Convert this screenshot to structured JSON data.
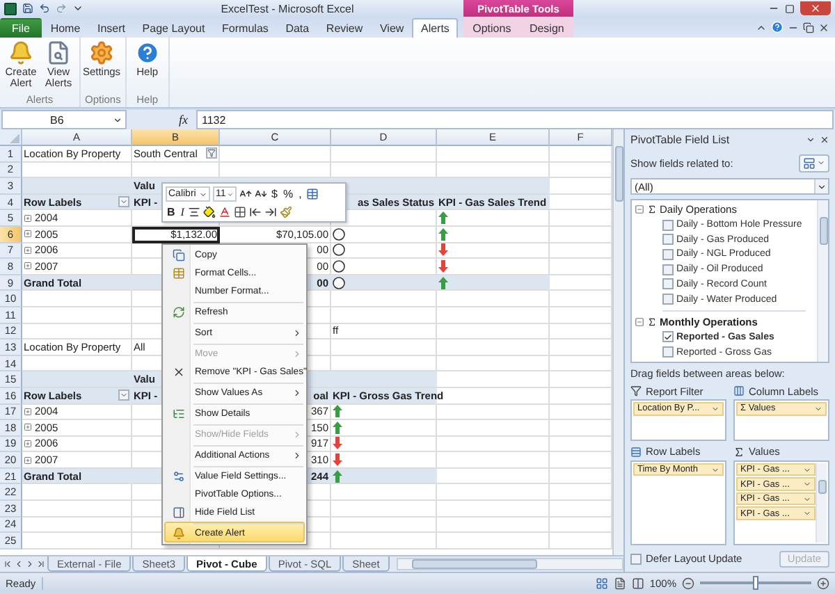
{
  "window": {
    "title": "ExcelTest - Microsoft Excel",
    "contextual_label": "PivotTable Tools"
  },
  "ribbon_tabs": [
    {
      "label": "File",
      "kind": "file",
      "selected": false
    },
    {
      "label": "Home",
      "kind": "main",
      "selected": false
    },
    {
      "label": "Insert",
      "kind": "main",
      "selected": false
    },
    {
      "label": "Page Layout",
      "kind": "main",
      "selected": false
    },
    {
      "label": "Formulas",
      "kind": "main",
      "selected": false
    },
    {
      "label": "Data",
      "kind": "main",
      "selected": false
    },
    {
      "label": "Review",
      "kind": "main",
      "selected": false
    },
    {
      "label": "View",
      "kind": "main",
      "selected": false
    },
    {
      "label": "Alerts",
      "kind": "main",
      "selected": true
    },
    {
      "label": "Options",
      "kind": "contextual",
      "selected": false
    },
    {
      "label": "Design",
      "kind": "contextual",
      "selected": false
    }
  ],
  "ribbon_groups": [
    {
      "label": "Alerts",
      "buttons": [
        {
          "label": "Create Alert",
          "kind": "bell"
        },
        {
          "label": "View Alerts",
          "kind": "view"
        }
      ]
    },
    {
      "label": "Options",
      "buttons": [
        {
          "label": "Settings",
          "kind": "gear"
        }
      ]
    },
    {
      "label": "Help",
      "buttons": [
        {
          "label": "Help",
          "kind": "help"
        }
      ]
    }
  ],
  "formula_bar": {
    "name_box": "B6",
    "fx": "fx",
    "value": "1132"
  },
  "columns": [
    {
      "label": "A",
      "selected": false
    },
    {
      "label": "B",
      "selected": true
    },
    {
      "label": "C",
      "selected": false
    },
    {
      "label": "D",
      "selected": false
    },
    {
      "label": "E",
      "selected": false
    },
    {
      "label": "F",
      "selected": false
    }
  ],
  "rows": [
    {
      "number": "1",
      "selected": false,
      "kind": "plain",
      "cells": [
        {
          "kind": "text",
          "text": "Location By Property"
        },
        {
          "kind": "filter",
          "text": "South Central"
        }
      ]
    },
    {
      "number": "2",
      "selected": false,
      "kind": "plain",
      "cells": []
    },
    {
      "number": "3",
      "selected": false,
      "kind": "header",
      "cells": [
        {},
        {
          "kind": "text",
          "text": "Valu"
        },
        {},
        {},
        {}
      ]
    },
    {
      "number": "4",
      "selected": false,
      "kind": "header",
      "cells": [
        {
          "kind": "dropdown",
          "text": "Row Labels"
        },
        {
          "kind": "text",
          "text": "KPI -"
        },
        {},
        {
          "kind": "number",
          "text": "as Sales Status"
        },
        {
          "kind": "text",
          "text": "KPI - Gas Sales Trend"
        }
      ]
    },
    {
      "number": "5",
      "selected": false,
      "kind": "plain",
      "cells": [
        {
          "kind": "expand",
          "text": "2004"
        },
        {},
        {},
        {},
        {
          "kind": "up"
        }
      ]
    },
    {
      "number": "6",
      "selected": true,
      "kind": "plain",
      "cells": [
        {
          "kind": "expand",
          "text": "2005"
        },
        {
          "kind": "active",
          "text": "$1,132.00"
        },
        {
          "kind": "number",
          "text": "$70,105.00"
        },
        {
          "kind": "status"
        },
        {
          "kind": "up"
        }
      ]
    },
    {
      "number": "7",
      "selected": false,
      "kind": "plain",
      "cells": [
        {
          "kind": "expand",
          "text": "2006"
        },
        {},
        {
          "kind": "number",
          "text": "00"
        },
        {
          "kind": "status"
        },
        {
          "kind": "down"
        }
      ]
    },
    {
      "number": "8",
      "selected": false,
      "kind": "plain",
      "cells": [
        {
          "kind": "expand",
          "text": "2007"
        },
        {},
        {
          "kind": "number",
          "text": "00"
        },
        {
          "kind": "status"
        },
        {
          "kind": "down"
        }
      ]
    },
    {
      "number": "9",
      "selected": false,
      "kind": "total",
      "cells": [
        {
          "kind": "text",
          "text": "Grand Total"
        },
        {},
        {
          "kind": "number",
          "text": "00"
        },
        {
          "kind": "status"
        },
        {
          "kind": "up"
        }
      ]
    },
    {
      "number": "10",
      "selected": false,
      "kind": "plain",
      "cells": []
    },
    {
      "number": "11",
      "selected": false,
      "kind": "plain",
      "cells": []
    },
    {
      "number": "12",
      "selected": false,
      "kind": "plain",
      "cells": [
        {},
        {},
        {},
        {
          "kind": "text",
          "text": "ff"
        }
      ]
    },
    {
      "number": "13",
      "selected": false,
      "kind": "plain",
      "cells": [
        {
          "kind": "text",
          "text": "Location By Property"
        },
        {
          "kind": "text",
          "text": "All"
        }
      ]
    },
    {
      "number": "14",
      "selected": false,
      "kind": "plain",
      "cells": []
    },
    {
      "number": "15",
      "selected": false,
      "kind": "header",
      "cells": [
        {},
        {
          "kind": "text",
          "text": "Valu"
        },
        {},
        {}
      ]
    },
    {
      "number": "16",
      "selected": false,
      "kind": "header",
      "cells": [
        {
          "kind": "dropdown",
          "text": "Row Labels"
        },
        {
          "kind": "text",
          "text": "KPI -"
        },
        {
          "kind": "number",
          "text": "oal"
        },
        {
          "kind": "text",
          "text": "KPI - Gross Gas Trend"
        }
      ]
    },
    {
      "number": "17",
      "selected": false,
      "kind": "plain",
      "cells": [
        {
          "kind": "expand",
          "text": "2004"
        },
        {},
        {
          "kind": "number",
          "text": "367"
        },
        {
          "kind": "up"
        }
      ]
    },
    {
      "number": "18",
      "selected": false,
      "kind": "plain",
      "cells": [
        {
          "kind": "expand",
          "text": "2005"
        },
        {},
        {
          "kind": "number",
          "text": "150"
        },
        {
          "kind": "up"
        }
      ]
    },
    {
      "number": "19",
      "selected": false,
      "kind": "plain",
      "cells": [
        {
          "kind": "expand",
          "text": "2006"
        },
        {},
        {
          "kind": "number",
          "text": "917"
        },
        {
          "kind": "down"
        }
      ]
    },
    {
      "number": "20",
      "selected": false,
      "kind": "plain",
      "cells": [
        {
          "kind": "expand",
          "text": "2007"
        },
        {},
        {
          "kind": "number",
          "text": "310"
        },
        {
          "kind": "down"
        }
      ]
    },
    {
      "number": "21",
      "selected": false,
      "kind": "total",
      "cells": [
        {
          "kind": "text",
          "text": "Grand Total"
        },
        {},
        {
          "kind": "number",
          "text": "244"
        },
        {
          "kind": "up"
        }
      ]
    },
    {
      "number": "22",
      "selected": false,
      "kind": "plain",
      "cells": []
    },
    {
      "number": "23",
      "selected": false,
      "kind": "plain",
      "cells": []
    },
    {
      "number": "24",
      "selected": false,
      "kind": "plain",
      "cells": []
    },
    {
      "number": "25",
      "selected": false,
      "kind": "plain",
      "cells": []
    }
  ],
  "mini_toolbar": {
    "font": "Calibri",
    "size": "11",
    "symbols": [
      "$",
      "%",
      ","
    ],
    "format_buttons": [
      "B",
      "I"
    ]
  },
  "context_menu": [
    {
      "label": "Copy",
      "kind": "copy",
      "disabled": false,
      "submenu": false,
      "separator_above": false,
      "selected": false
    },
    {
      "label": "Format Cells...",
      "kind": "format",
      "disabled": false,
      "submenu": false,
      "separator_above": false,
      "selected": false
    },
    {
      "label": "Number Format...",
      "kind": "none",
      "disabled": false,
      "submenu": false,
      "separator_above": false,
      "selected": false
    },
    {
      "label": "Refresh",
      "kind": "refresh",
      "disabled": false,
      "submenu": false,
      "separator_above": true,
      "selected": false
    },
    {
      "label": "Sort",
      "kind": "none",
      "disabled": false,
      "submenu": true,
      "separator_above": true,
      "selected": false
    },
    {
      "label": "Move",
      "kind": "none",
      "disabled": true,
      "submenu": true,
      "separator_above": true,
      "selected": false
    },
    {
      "label": "Remove \"KPI - Gas Sales\"",
      "kind": "remove",
      "disabled": false,
      "submenu": false,
      "separator_above": false,
      "selected": false
    },
    {
      "label": "Show Values As",
      "kind": "none",
      "disabled": false,
      "submenu": true,
      "separator_above": true,
      "selected": false
    },
    {
      "label": "Show Details",
      "kind": "details",
      "disabled": false,
      "submenu": false,
      "separator_above": true,
      "selected": false
    },
    {
      "label": "Show/Hide Fields",
      "kind": "none",
      "disabled": true,
      "submenu": true,
      "separator_above": true,
      "selected": false
    },
    {
      "label": "Additional Actions",
      "kind": "none",
      "disabled": false,
      "submenu": true,
      "separator_above": true,
      "selected": false
    },
    {
      "label": "Value Field Settings...",
      "kind": "settings",
      "disabled": false,
      "submenu": false,
      "separator_above": true,
      "selected": false
    },
    {
      "label": "PivotTable Options...",
      "kind": "none",
      "disabled": false,
      "submenu": false,
      "separator_above": false,
      "selected": false
    },
    {
      "label": "Hide Field List",
      "kind": "fieldlist",
      "disabled": false,
      "submenu": false,
      "separator_above": false,
      "selected": false
    },
    {
      "label": "Create Alert",
      "kind": "alert",
      "disabled": false,
      "submenu": false,
      "separator_above": true,
      "selected": true
    }
  ],
  "field_list": {
    "title": "PivotTable Field List",
    "related_label": "Show fields related to:",
    "related_value": "(All)",
    "groups": [
      {
        "label": "Daily Operations",
        "expanded": true,
        "fields": [
          {
            "label": "Daily - Bottom Hole Pressure",
            "checked": false
          },
          {
            "label": "Daily - Gas Produced",
            "checked": false
          },
          {
            "label": "Daily - NGL Produced",
            "checked": false
          },
          {
            "label": "Daily - Oil Produced",
            "checked": false
          },
          {
            "label": "Daily - Record Count",
            "checked": false
          },
          {
            "label": "Daily - Water Produced",
            "checked": false
          }
        ]
      },
      {
        "label": "Monthly Operations",
        "expanded": true,
        "fields": [
          {
            "label": "Reported - Gas Sales",
            "checked": true
          },
          {
            "label": "Reported - Gross Gas",
            "checked": false
          }
        ]
      }
    ],
    "drag_label": "Drag fields between areas below:",
    "areas": [
      {
        "label": "Report Filter",
        "kind": "filter",
        "items": [
          "Location By P..."
        ]
      },
      {
        "label": "Column Labels",
        "kind": "columns",
        "items": [
          "Σ Values"
        ]
      },
      {
        "label": "Row Labels",
        "kind": "rows",
        "items": [
          "Time By Month"
        ]
      },
      {
        "label": "Values",
        "kind": "values",
        "items": [
          "KPI - Gas ...",
          "KPI - Gas ...",
          "KPI - Gas ...",
          "KPI - Gas ..."
        ]
      }
    ],
    "defer": {
      "label": "Defer Layout Update",
      "checked": false
    },
    "update_button": {
      "label": "Update",
      "disabled": true
    }
  },
  "sheet_tabs": [
    {
      "label": "External - File",
      "selected": false
    },
    {
      "label": "Sheet3",
      "selected": false
    },
    {
      "label": "Pivot - Cube",
      "selected": true
    },
    {
      "label": "Pivot - SQL",
      "selected": false
    },
    {
      "label": "Sheet",
      "selected": false
    }
  ],
  "status_bar": {
    "text": "Ready",
    "zoom": "100%",
    "level": 0.5
  }
}
